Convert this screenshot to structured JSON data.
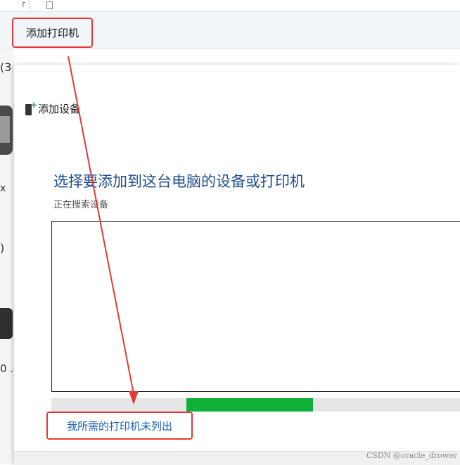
{
  "toolbar": {
    "add_printer_label": "添加打印机"
  },
  "background_window": {
    "count_text": "(3",
    "fragment_x": "x",
    "fragment_paren": ")",
    "fragment_zero": "0 ."
  },
  "dialog": {
    "title": "添加设备",
    "heading": "选择要添加到这台电脑的设备或打印机",
    "status": "正在搜索设备",
    "progress": {
      "segment_start": 0.33,
      "segment_end": 0.64
    },
    "not_listed_link": "我所需的打印机未列出"
  },
  "watermark": "CSDN @oracle_drower",
  "colors": {
    "annotation_red": "#e53935",
    "heading_blue": "#1f4e8c",
    "link_blue": "#1a5fb4",
    "progress_green": "#10b03a"
  },
  "icons": [
    "add-device-icon",
    "printer-icon"
  ]
}
